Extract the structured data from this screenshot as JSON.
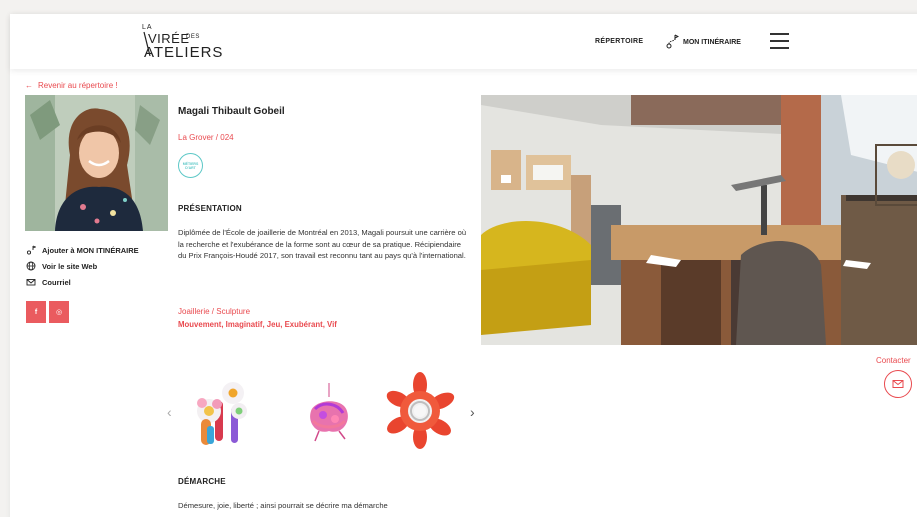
{
  "header": {
    "logo": {
      "line1": "LA",
      "line2": "VIRÉE",
      "line2_small": "DES",
      "line3": "ATELIERS"
    },
    "nav_repertoire": "RÉPERTOIRE",
    "nav_itinerary": "MON ITINÉRAIRE",
    "menu_icon": "hamburger-icon"
  },
  "back_link": {
    "arrow": "←",
    "label": "Revenir au répertoire !"
  },
  "profile": {
    "name": "Magali Thibault Gobeil",
    "location": "La Grover / 024",
    "badge": "MÉTIERS D'ART",
    "actions": [
      {
        "icon": "itinerary-icon",
        "label": "Ajouter à MON ITINÉRAIRE"
      },
      {
        "icon": "globe-icon",
        "label": "Voir le site Web"
      },
      {
        "icon": "mail-icon",
        "label": "Courriel"
      }
    ],
    "socials": [
      {
        "icon": "facebook-icon",
        "label": "f"
      },
      {
        "icon": "instagram-icon",
        "label": "◎"
      }
    ]
  },
  "presentation": {
    "title": "PRÉSENTATION",
    "text": "Diplômée de l'École de joaillerie de Montréal en 2013, Magali poursuit une carrière où la recherche et l'exubérance de la forme sont au cœur de sa pratique. Récipiendaire du Prix François-Houdé 2017, son travail est reconnu tant au pays qu'à l'international."
  },
  "disciplines": "Joaillerie / Sculpture",
  "tags": "Mouvement, Imaginatif, Jeu, Exubérant, Vif",
  "gallery": {
    "prev": "‹",
    "next": "›"
  },
  "demarche": {
    "title": "DÉMARCHE",
    "text": "Démesure, joie, liberté ; ainsi pourrait se décrire ma démarche"
  },
  "contact": {
    "label": "Contacter"
  },
  "colors": {
    "accent": "#e94a4f",
    "badge": "#5dc8c7"
  }
}
